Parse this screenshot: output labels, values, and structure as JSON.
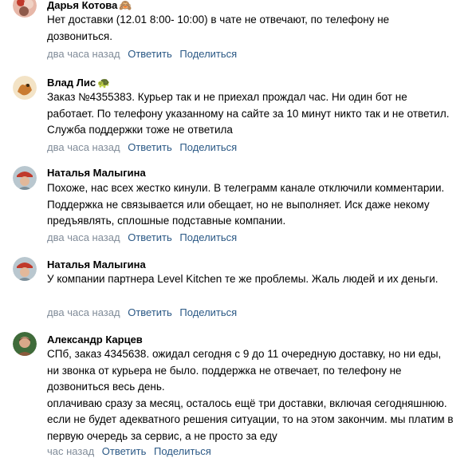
{
  "comments": [
    {
      "author": "Дарья Котова",
      "emoji": "🙈",
      "text": "Нет доставки (12.01 8:00- 10:00) в чате не отвечают, по телефону не дозвониться.",
      "time": "два часа назад",
      "reply": "Ответить",
      "share": "Поделиться"
    },
    {
      "author": "Влад Лис",
      "emoji": "🐢",
      "text": "Заказ №4355383. Курьер так и не приехал прождал час. Ни один бот не работает. По телефону указанному на сайте за 10 минут никто так и не ответил. Служба поддержки тоже не ответила",
      "time": "два часа назад",
      "reply": "Ответить",
      "share": "Поделиться"
    },
    {
      "author": "Наталья Малыгина",
      "text": "Похоже, нас всех жестко кинули. В телеграмм канале отключили комментарии. Поддержка не связывается или обещает, но не выполняет. Иск даже некому предъявлять, сплошные подставные компании.",
      "time": "два часа назад",
      "reply": "Ответить",
      "share": "Поделиться"
    },
    {
      "author": "Наталья Малыгина",
      "text": "У компании партнера Level Kitchen те же проблемы. Жаль людей и их деньги.",
      "time": "два часа назад",
      "reply": "Ответить",
      "share": "Поделиться"
    },
    {
      "author": "Александр Карцев",
      "text": "СПб, заказ 4345638. ожидал сегодня с 9 до 11 очередную доставку, но ни еды, ни звонка от курьера не было. поддержка не отвечает, по телефону не дозвониться весь день.\nоплачиваю сразу за месяц, осталось ещё три доставки, включая сегодняшнюю. если не будет адекватного решения ситуации, то на этом закончим. мы платим в первую очередь за сервис, а не просто за еду",
      "time": "час назад",
      "reply": "Ответить",
      "share": "Поделиться"
    }
  ],
  "colors": {
    "link": "#2a5885",
    "meta": "#818c99",
    "text": "#000000"
  }
}
